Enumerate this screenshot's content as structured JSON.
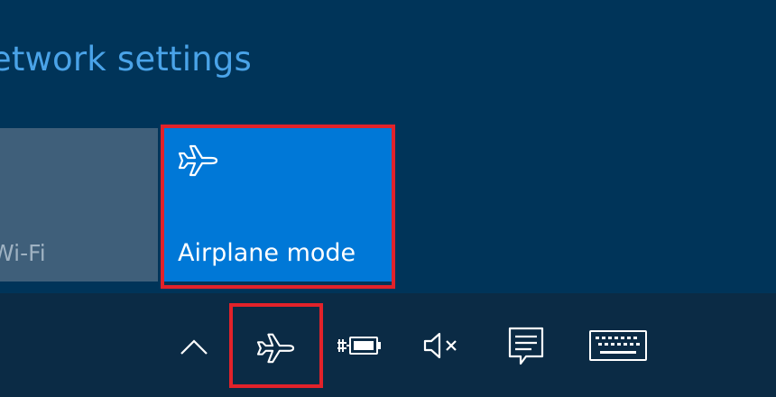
{
  "flyout": {
    "network_settings_link": "Network settings",
    "tiles": [
      {
        "label": "Wi-Fi",
        "state": "off"
      },
      {
        "label": "Airplane mode",
        "state": "on",
        "icon": "airplane-icon"
      }
    ]
  },
  "taskbar": {
    "tray_icons": [
      {
        "name": "show-hidden-icons",
        "icon": "chevron-up-icon"
      },
      {
        "name": "airplane-mode-status",
        "icon": "airplane-icon"
      },
      {
        "name": "battery-status",
        "icon": "battery-charging-icon"
      },
      {
        "name": "volume-status",
        "icon": "volume-muted-icon"
      },
      {
        "name": "action-center",
        "icon": "action-center-icon"
      },
      {
        "name": "touch-keyboard",
        "icon": "keyboard-icon"
      }
    ]
  },
  "colors": {
    "accent": "#0078d7",
    "link": "#4aa3e8",
    "flyout_bg": "#003459",
    "taskbar_bg": "#0b2b45",
    "highlight": "#e2222a"
  }
}
